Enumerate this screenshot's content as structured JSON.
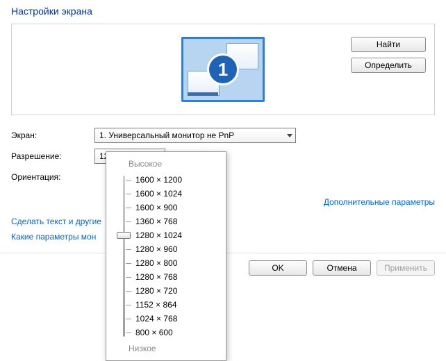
{
  "title": "Настройки экрана",
  "preview": {
    "monitor_number": "1",
    "buttons": {
      "find": "Найти",
      "detect": "Определить"
    }
  },
  "form": {
    "screen_label": "Экран:",
    "screen_value": "1. Универсальный монитор не PnP",
    "resolution_label": "Разрешение:",
    "resolution_value": "1280 × 1024",
    "orientation_label": "Ориентация:"
  },
  "advanced_link": "Дополнительные параметры",
  "help_links": {
    "text_size": "Сделать текст и другие",
    "which_settings": "Какие параметры мон"
  },
  "dialog_buttons": {
    "ok": "OK",
    "cancel": "Отмена",
    "apply": "Применить"
  },
  "resolution_popup": {
    "high_label": "Высокое",
    "low_label": "Низкое",
    "selected_index": 4,
    "options": [
      "1600 × 1200",
      "1600 × 1024",
      "1600 × 900",
      "1360 × 768",
      "1280 × 1024",
      "1280 × 960",
      "1280 × 800",
      "1280 × 768",
      "1280 × 720",
      "1152 × 864",
      "1024 × 768",
      "800 × 600"
    ]
  }
}
